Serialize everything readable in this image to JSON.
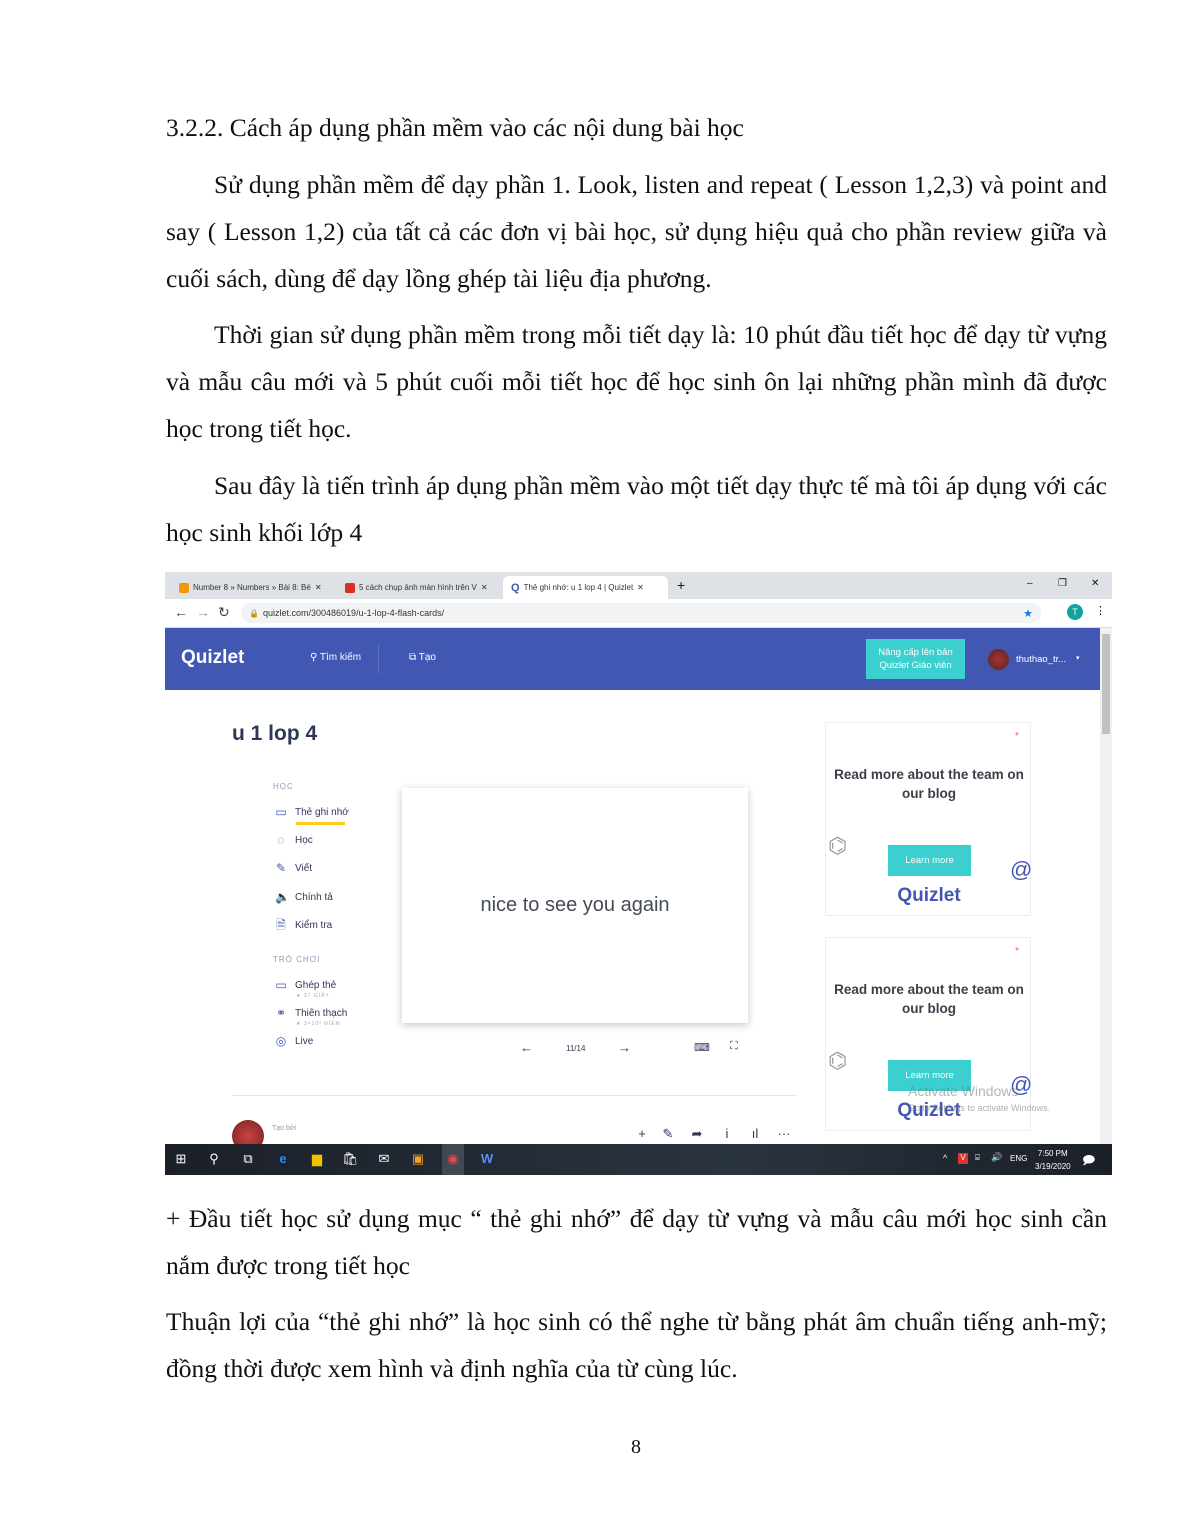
{
  "document": {
    "heading": "3.2.2. Cách áp dụng phần mềm vào các nội dung bài học",
    "para1": "Sử dụng phần mềm để dạy phần 1. Look, listen and repeat ( Lesson 1,2,3) và point and say ( Lesson 1,2) của tất cả các đơn vị bài học, sử dụng hiệu quả cho phần review giữa và cuối sách, dùng để dạy lồng ghép  tài liệu địa phương.",
    "para2": "Thời gian sử dụng phần mềm trong mỗi tiết dạy là: 10 phút đầu tiết học để dạy từ vựng và mẫu câu mới và 5 phút cuối mỗi tiết học để học sinh ôn lại những phần mình đã được học trong tiết học.",
    "para3": "Sau đây là tiến trình áp dụng phần mềm vào một tiết dạy thực tế mà tôi áp dụng với các học sinh khối lớp 4",
    "para4": "+ Đầu tiết học sử dụng mục “ thẻ ghi nhớ” để dạy từ vựng và mẫu câu mới học sinh cần nắm được trong tiết học",
    "para5": "Thuận lợi của “thẻ ghi nhớ” là học sinh có thể nghe từ bằng phát âm chuẩn tiếng anh-mỹ; đồng thời được xem hình và định nghĩa của từ cùng lúc.",
    "page_number": "8"
  },
  "screenshot": {
    "tabs": [
      {
        "label": "Number 8 » Numbers » Bài 8: Bé",
        "color": "#f29900"
      },
      {
        "label": "5 cách chụp ảnh màn hình trên V",
        "color": "#d93025"
      },
      {
        "label": "Thẻ ghi nhớ: u 1 lop 4 | Quizlet",
        "color": "#4257b2",
        "active": true
      }
    ],
    "new_tab": "+",
    "window_controls": [
      "–",
      "❐",
      "✕"
    ],
    "url": "quizlet.com/300486019/u-1-lop-4-flash-cards/",
    "profile_initial": "T",
    "nav": {
      "logo": "Quizlet",
      "search": "Tìm kiếm",
      "create": "Tạo",
      "upgrade": "Nâng cấp lên bản Quizlet Giáo viên",
      "username": "thuthao_tr..."
    },
    "set_title": "u 1 lop 4",
    "study_section": "HỌC",
    "study_items": [
      {
        "label": "Thẻ ghi nhớ",
        "icon": "cards-icon",
        "active": true
      },
      {
        "label": "Học",
        "icon": "learn-icon"
      },
      {
        "label": "Viết",
        "icon": "write-icon"
      },
      {
        "label": "Chính tả",
        "icon": "spell-icon"
      },
      {
        "label": "Kiểm tra",
        "icon": "test-icon"
      }
    ],
    "games_section": "TRÒ CHƠI",
    "game_items": [
      {
        "label": "Ghép thẻ",
        "sub": "★ 37 GIÂY",
        "icon": "match-icon"
      },
      {
        "label": "Thiên thạch",
        "sub": "★ 3×10³ ĐIỂM",
        "icon": "gravity-icon"
      },
      {
        "label": "Live",
        "sub": "",
        "icon": "live-icon"
      }
    ],
    "card_text": "nice to see you again",
    "card_progress": "11/14",
    "created_by": "Tạo bởi",
    "ads": [
      {
        "title": "Read more about the team on our blog",
        "button": "Learn more",
        "logo": "Quizlet"
      },
      {
        "title": "Read more about the team on our blog",
        "button": "Learn more",
        "logo": "Quizlet"
      }
    ],
    "watermark": {
      "line1": "Activate Windows",
      "line2": "Go to Settings to activate Windows."
    },
    "taskbar": {
      "lang": "ENG",
      "time": "7:50 PM",
      "date": "3/19/2020"
    },
    "colors": {
      "quizlet_blue": "#4257b2",
      "accent_teal": "#3ccfcf",
      "active_underline": "#ffcd1f"
    }
  }
}
